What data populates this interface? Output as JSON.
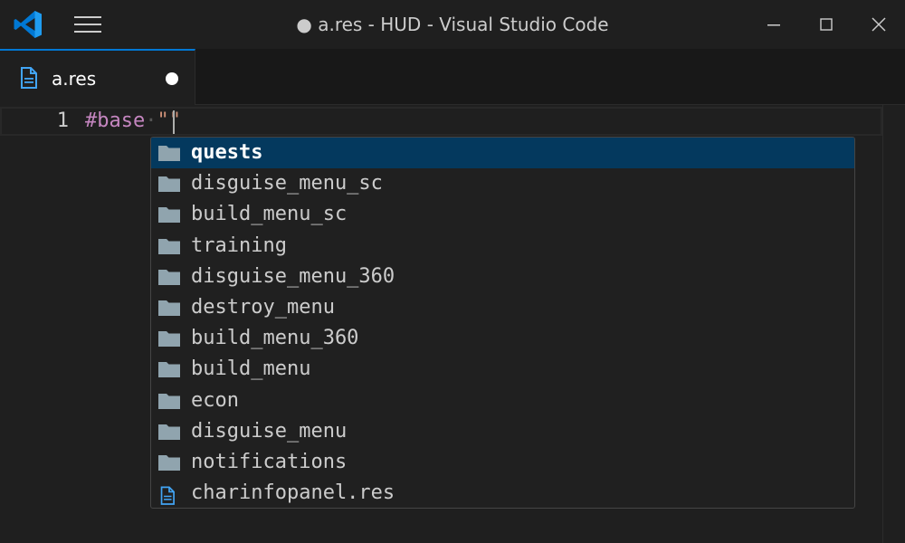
{
  "window": {
    "title": "● a.res - HUD - Visual Studio Code"
  },
  "colors": {
    "accent": "#0078d4",
    "folder_icon": "#90a4ae",
    "file_icon": "#42a5f5",
    "selection": "#04395e"
  },
  "icons": {
    "logo": "vscode-logo-icon",
    "menu": "hamburger-menu-icon",
    "minimize": "minimize-icon",
    "maximize": "maximize-icon",
    "close": "close-icon",
    "tab_file": "file-icon",
    "folder": "folder-icon"
  },
  "tab": {
    "label": "a.res",
    "dirty": true
  },
  "editor": {
    "line_number": "1",
    "directive": "#base",
    "whitespace": "·",
    "string": "\"\""
  },
  "suggestions": [
    {
      "label": "quests",
      "kind": "folder",
      "selected": true
    },
    {
      "label": "disguise_menu_sc",
      "kind": "folder"
    },
    {
      "label": "build_menu_sc",
      "kind": "folder"
    },
    {
      "label": "training",
      "kind": "folder"
    },
    {
      "label": "disguise_menu_360",
      "kind": "folder"
    },
    {
      "label": "destroy_menu",
      "kind": "folder"
    },
    {
      "label": "build_menu_360",
      "kind": "folder"
    },
    {
      "label": "build_menu",
      "kind": "folder"
    },
    {
      "label": "econ",
      "kind": "folder"
    },
    {
      "label": "disguise_menu",
      "kind": "folder"
    },
    {
      "label": "notifications",
      "kind": "folder"
    },
    {
      "label": "charinfopanel.res",
      "kind": "file"
    }
  ]
}
